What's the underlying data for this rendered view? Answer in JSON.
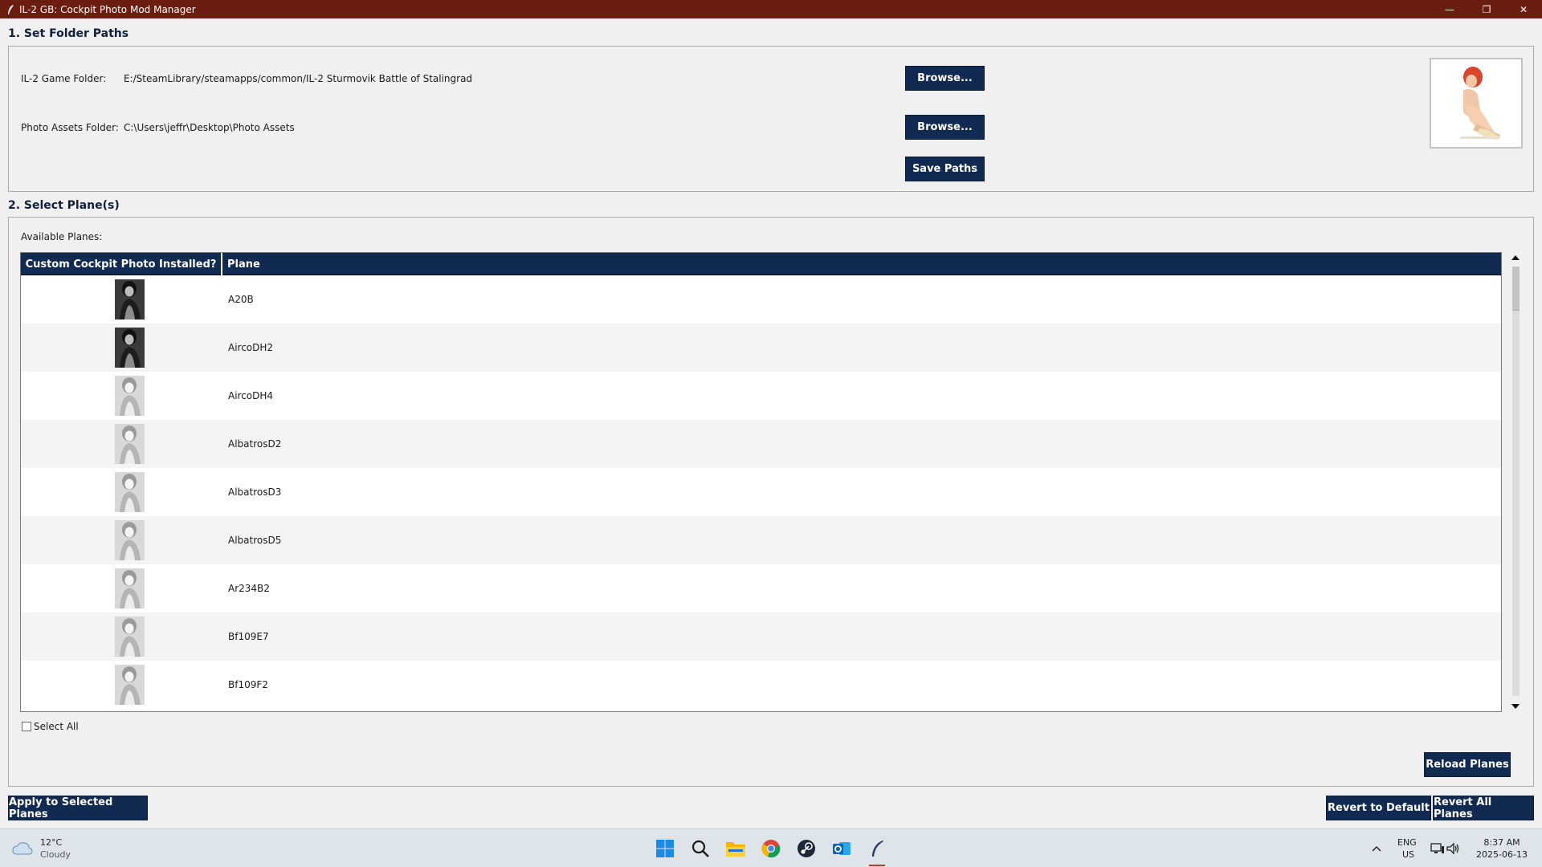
{
  "window": {
    "title": "IL-2 GB: Cockpit Photo Mod Manager",
    "minimize_glyph": "—",
    "restore_glyph": "❐",
    "close_glyph": "✕"
  },
  "folders": {
    "section_title": "1. Set Folder Paths",
    "game_label": "IL-2 Game Folder:",
    "game_path": "E:/SteamLibrary/steamapps/common/IL-2 Sturmovik Battle of Stalingrad",
    "assets_label": "Photo Assets Folder:",
    "assets_path": "C:\\Users\\jeffr\\Desktop\\Photo Assets",
    "browse_label": "Browse...",
    "save_label": "Save Paths"
  },
  "planes": {
    "section_title": "2. Select Plane(s)",
    "available_label": "Available Planes:",
    "col_photo": "Custom Cockpit Photo Installed?",
    "col_plane": "Plane",
    "rows": [
      {
        "name": "A20B",
        "photo": "dark"
      },
      {
        "name": "AircoDH2",
        "photo": "dark"
      },
      {
        "name": "AircoDH4",
        "photo": "light"
      },
      {
        "name": "AlbatrosD2",
        "photo": "light"
      },
      {
        "name": "AlbatrosD3",
        "photo": "light"
      },
      {
        "name": "AlbatrosD5",
        "photo": "light"
      },
      {
        "name": "Ar234B2",
        "photo": "light"
      },
      {
        "name": "Bf109E7",
        "photo": "light"
      },
      {
        "name": "Bf109F2",
        "photo": "light"
      }
    ],
    "select_all_label": "Select All",
    "reload_label": "Reload Planes"
  },
  "actions": {
    "apply_label": "Apply to Selected Planes",
    "revert_default_label": "Revert to Default",
    "revert_all_label": "Revert All Planes"
  },
  "taskbar": {
    "weather_temp": "12°C",
    "weather_desc": "Cloudy",
    "lang": "ENG",
    "region": "US",
    "time": "8:37 AM",
    "date": "2025-06-13",
    "apps": [
      "windows-start-icon",
      "search-icon",
      "file-explorer-icon",
      "chrome-icon",
      "steam-icon",
      "outlook-icon",
      "quill-app-icon"
    ]
  },
  "colors": {
    "titlebar": "#6b1d10",
    "accent": "#112a52"
  }
}
